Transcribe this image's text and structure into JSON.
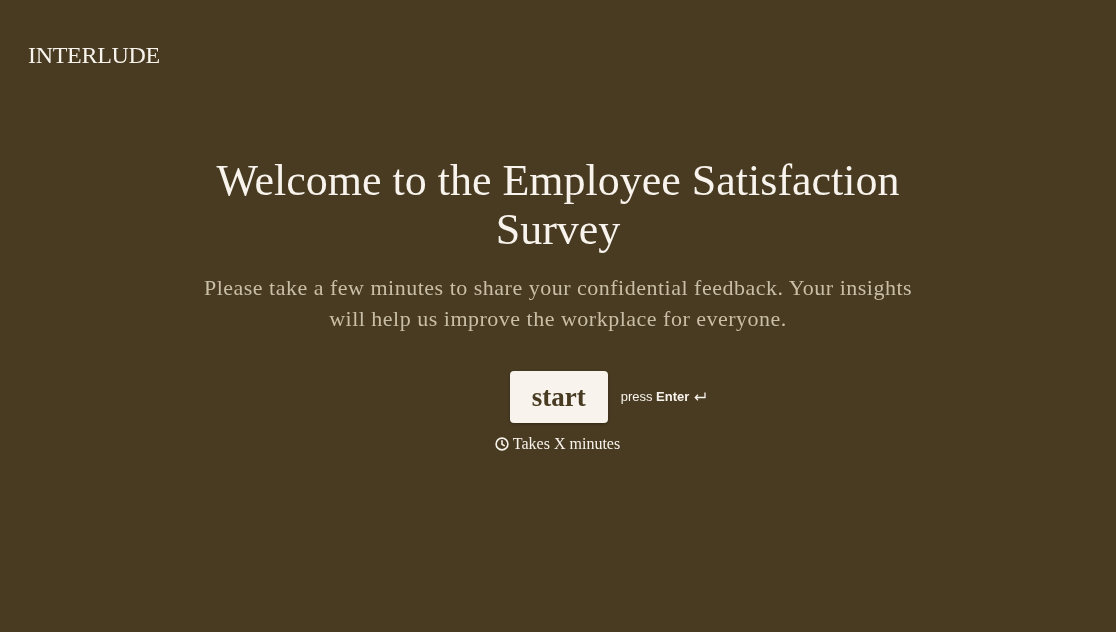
{
  "brand": {
    "logo": "INTERLUDE"
  },
  "welcome": {
    "title": "Welcome to the Employee Satisfaction Survey",
    "description": "Please take a few minutes to share your confidential feedback. Your insights will help us improve the workplace for everyone.",
    "start_button": "start",
    "keyboard_hint": "press **Enter**",
    "duration": "Takes X minutes"
  }
}
